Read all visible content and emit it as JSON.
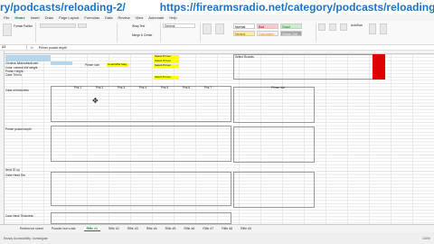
{
  "banner": {
    "left_text": "ry/podcasts/reloading-2/",
    "right_text": "https://firearmsradio.net/category/podcasts/reloading-2/"
  },
  "menu": [
    "File",
    "Home",
    "Insert",
    "Draw",
    "Page Layout",
    "Formulas",
    "Data",
    "Review",
    "View",
    "Automate",
    "Help"
  ],
  "ribbon": {
    "cell_styles": {
      "normal": "Normal",
      "bad": "Bad",
      "good": "Good",
      "neutral": "Neutral",
      "calculation": "Calculation",
      "check_cell": "Check Cell"
    },
    "clipboard": {
      "paste": "Paste",
      "format_painter": "Format Painter"
    },
    "wrap_text": "Wrap Text",
    "merge": "Merge & Center",
    "number_format": "General",
    "conditional": "Conditional Formatting",
    "format_as_table": "Format as Table",
    "autosum": "AutoSum",
    "sort": "Sort & Filter",
    "find": "Find & Select"
  },
  "formula_bar": {
    "name_box": "A3",
    "fx": "fx",
    "value": "Primer pocket depth"
  },
  "sheet": {
    "top_labels": [
      "Grains Manufacturer",
      "Color, colored 4W weight",
      "Primer Height",
      "Case Trim to"
    ],
    "primer_size_label": "Primer size",
    "yellow_label": "Small Rifle Mag",
    "yellow_cells": [
      "Select Primer",
      "Select Primer",
      "Select Primer",
      "Select Primer"
    ],
    "sections": [
      "Case oil thickness",
      "Primer pocket depth",
      "Neck ID up",
      "Case Head Dia",
      "Case Neck Thickness"
    ],
    "col_headers": [
      "Pos 1",
      "Pos 2",
      "Pos 3",
      "Pos 4",
      "Pos 5",
      "Pos 6",
      "Pos 7",
      "Pos 8"
    ],
    "right_label": "Select Rounds",
    "chart_title": "Primer dia"
  },
  "tabs": [
    "Reference sheet",
    "Powder burn rate",
    "Rifle #1",
    "Rifle #2",
    "Rifle #3",
    "Rifle #4",
    "Rifle #5",
    "Rifle #6",
    "Rifle #7",
    "Rifle #8",
    "Rifle #9"
  ],
  "active_tab": "Rifle #1",
  "status": {
    "left": "Ready   Accessibility: Investigate",
    "right": "100%"
  },
  "colors": {
    "link": "#1a73c8",
    "highlight": "#ffff00",
    "accent": "#107c41",
    "alert": "#e00000"
  }
}
